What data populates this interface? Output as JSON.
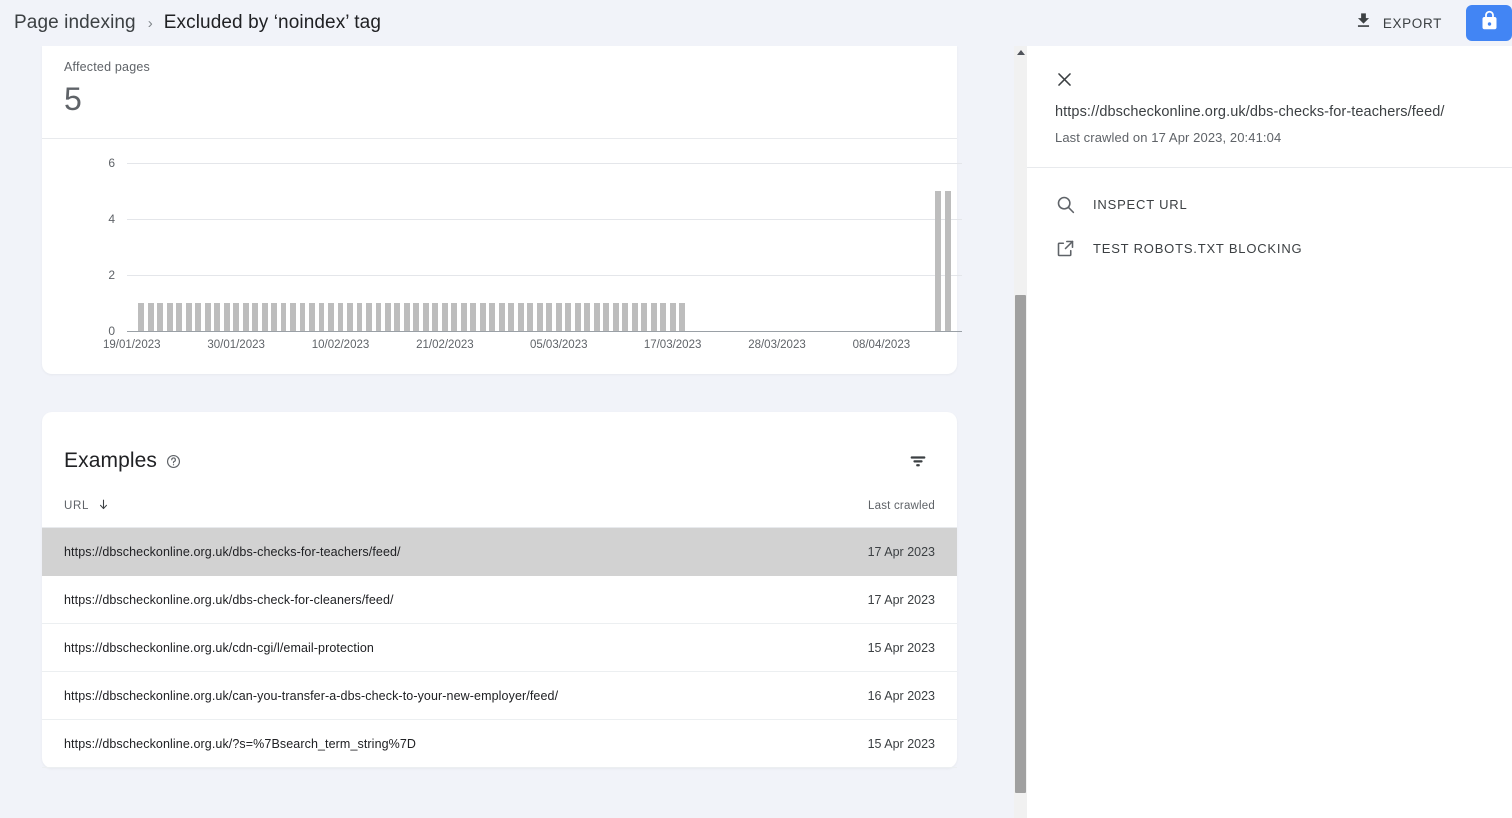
{
  "header": {
    "breadcrumb_root": "Page indexing",
    "breadcrumb_separator": "›",
    "breadcrumb_current": "Excluded by ‘noindex’ tag",
    "export_label": "EXPORT",
    "export_icon": "download-icon",
    "lock_icon": "lock-icon",
    "lock_button_color": "#4285f4"
  },
  "summary": {
    "label": "Affected pages",
    "value": "5"
  },
  "chart_data": {
    "type": "bar",
    "title": "",
    "xlabel": "",
    "ylabel": "",
    "ylim": [
      0,
      6
    ],
    "yticks": [
      0,
      2,
      4,
      6
    ],
    "ytick_labels": [
      "0",
      "2",
      "4",
      "6"
    ],
    "grid": true,
    "legend": "none",
    "bar_color": "#bdbdbd",
    "xtick_labels": [
      "19/01/2023",
      "30/01/2023",
      "10/02/2023",
      "21/02/2023",
      "05/03/2023",
      "17/03/2023",
      "28/03/2023",
      "08/04/2023"
    ],
    "x": [
      "19/01/2023",
      "20/01/2023",
      "21/01/2023",
      "22/01/2023",
      "23/01/2023",
      "24/01/2023",
      "25/01/2023",
      "26/01/2023",
      "27/01/2023",
      "28/01/2023",
      "29/01/2023",
      "30/01/2023",
      "31/01/2023",
      "01/02/2023",
      "02/02/2023",
      "03/02/2023",
      "04/02/2023",
      "05/02/2023",
      "06/02/2023",
      "07/02/2023",
      "08/02/2023",
      "09/02/2023",
      "10/02/2023",
      "11/02/2023",
      "12/02/2023",
      "13/02/2023",
      "14/02/2023",
      "15/02/2023",
      "16/02/2023",
      "17/02/2023",
      "18/02/2023",
      "19/02/2023",
      "20/02/2023",
      "21/02/2023",
      "22/02/2023",
      "23/02/2023",
      "24/02/2023",
      "25/02/2023",
      "26/02/2023",
      "27/02/2023",
      "28/02/2023",
      "01/03/2023",
      "02/03/2023",
      "03/03/2023",
      "04/03/2023",
      "05/03/2023",
      "06/03/2023",
      "07/03/2023",
      "08/03/2023",
      "09/03/2023",
      "10/03/2023",
      "11/03/2023",
      "12/03/2023",
      "13/03/2023",
      "14/03/2023",
      "15/03/2023",
      "16/03/2023",
      "17/03/2023",
      "18/03/2023",
      "19/03/2023",
      "20/03/2023",
      "21/03/2023",
      "22/03/2023",
      "23/03/2023",
      "24/03/2023",
      "25/03/2023",
      "26/03/2023",
      "27/03/2023",
      "28/03/2023",
      "29/03/2023",
      "30/03/2023",
      "31/03/2023",
      "01/04/2023",
      "02/04/2023",
      "03/04/2023",
      "04/04/2023",
      "05/04/2023",
      "06/04/2023",
      "07/04/2023",
      "08/04/2023",
      "09/04/2023",
      "10/04/2023",
      "11/04/2023",
      "12/04/2023",
      "13/04/2023",
      "14/04/2023",
      "15/04/2023",
      "16/04/2023",
      "17/04/2023"
    ],
    "values": [
      0,
      1,
      1,
      1,
      1,
      1,
      1,
      1,
      1,
      1,
      1,
      1,
      1,
      1,
      1,
      1,
      1,
      1,
      1,
      1,
      1,
      1,
      1,
      1,
      1,
      1,
      1,
      1,
      1,
      1,
      1,
      1,
      1,
      1,
      1,
      1,
      1,
      1,
      1,
      1,
      1,
      1,
      1,
      1,
      1,
      1,
      1,
      1,
      1,
      1,
      1,
      1,
      1,
      1,
      1,
      1,
      1,
      1,
      1,
      0,
      0,
      0,
      0,
      0,
      0,
      0,
      0,
      0,
      0,
      0,
      0,
      0,
      0,
      0,
      0,
      0,
      0,
      0,
      0,
      0,
      0,
      0,
      0,
      0,
      0,
      5,
      5,
      0
    ]
  },
  "examples": {
    "title": "Examples",
    "help_icon": "help-icon",
    "filter_icon": "filter-icon",
    "columns": {
      "url": "URL",
      "sort_icon": "sort-descending-arrow-icon",
      "last_crawled": "Last crawled"
    },
    "rows": [
      {
        "url": "https://dbscheckonline.org.uk/dbs-checks-for-teachers/feed/",
        "last_crawled": "17 Apr 2023",
        "selected": true
      },
      {
        "url": "https://dbscheckonline.org.uk/dbs-check-for-cleaners/feed/",
        "last_crawled": "17 Apr 2023",
        "selected": false
      },
      {
        "url": "https://dbscheckonline.org.uk/cdn-cgi/l/email-protection",
        "last_crawled": "15 Apr 2023",
        "selected": false
      },
      {
        "url": "https://dbscheckonline.org.uk/can-you-transfer-a-dbs-check-to-your-new-employer/feed/",
        "last_crawled": "16 Apr 2023",
        "selected": false
      },
      {
        "url": "https://dbscheckonline.org.uk/?s=%7Bsearch_term_string%7D",
        "last_crawled": "15 Apr 2023",
        "selected": false
      }
    ]
  },
  "panel": {
    "close_icon": "close-icon",
    "url": "https://dbscheckonline.org.uk/dbs-checks-for-teachers/feed/",
    "last_crawled": "Last crawled on 17 Apr 2023, 20:41:04",
    "actions": [
      {
        "icon": "search-icon",
        "label": "INSPECT URL"
      },
      {
        "icon": "open-in-new-icon",
        "label": "TEST ROBOTS.TXT BLOCKING"
      }
    ]
  },
  "scrollbar": {
    "up_arrow_icon": "scroll-up-arrow-icon"
  }
}
